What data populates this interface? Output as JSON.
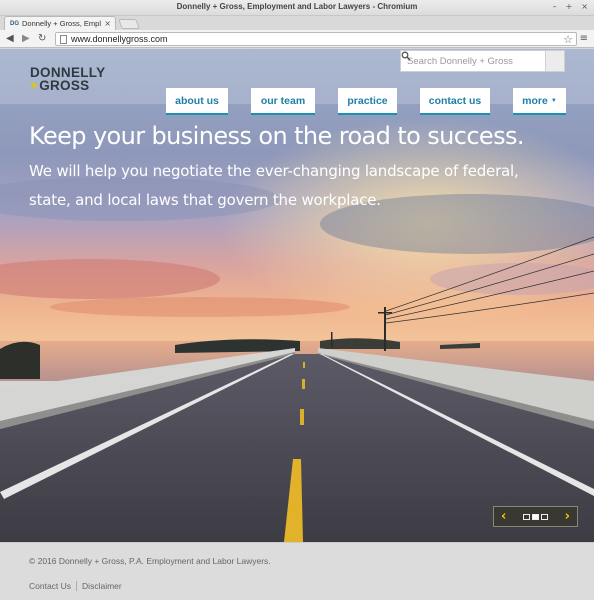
{
  "browser": {
    "window_title": "Donnelly + Gross, Employment and Labor Lawyers - Chromium",
    "tab_title": "Donnelly + Gross, Employ",
    "tab_favicon": "DG",
    "url": "www.donnellygross.com",
    "icons": {
      "back": "back-arrow-icon",
      "forward": "forward-arrow-icon",
      "reload": "reload-icon",
      "bookmark": "star-icon",
      "menu": "hamburger-menu-icon"
    }
  },
  "site": {
    "logo_line1": "DONNELLY",
    "logo_plus": "+",
    "logo_line2": "GROSS",
    "search_placeholder": "Search Donnelly + Gross",
    "nav": [
      "about us",
      "our team",
      "practice",
      "contact us",
      "more"
    ],
    "hero_title": "Keep your business on the road to success.",
    "hero_subtitle": "We will help you negotiate the ever-changing landscape of federal, state, and local laws that govern the workplace.",
    "slider": {
      "slide_count": 3,
      "active_slide": 2
    },
    "footer": {
      "copyright": "© 2016 Donnelly + Gross, P.A. Employment and Labor Lawyers.",
      "links": [
        "Contact Us",
        "Disclaimer"
      ]
    },
    "colors": {
      "accent": "#1d7fa8",
      "logo_plus": "#e8c700",
      "slider_arrow": "#f1cb00"
    }
  }
}
